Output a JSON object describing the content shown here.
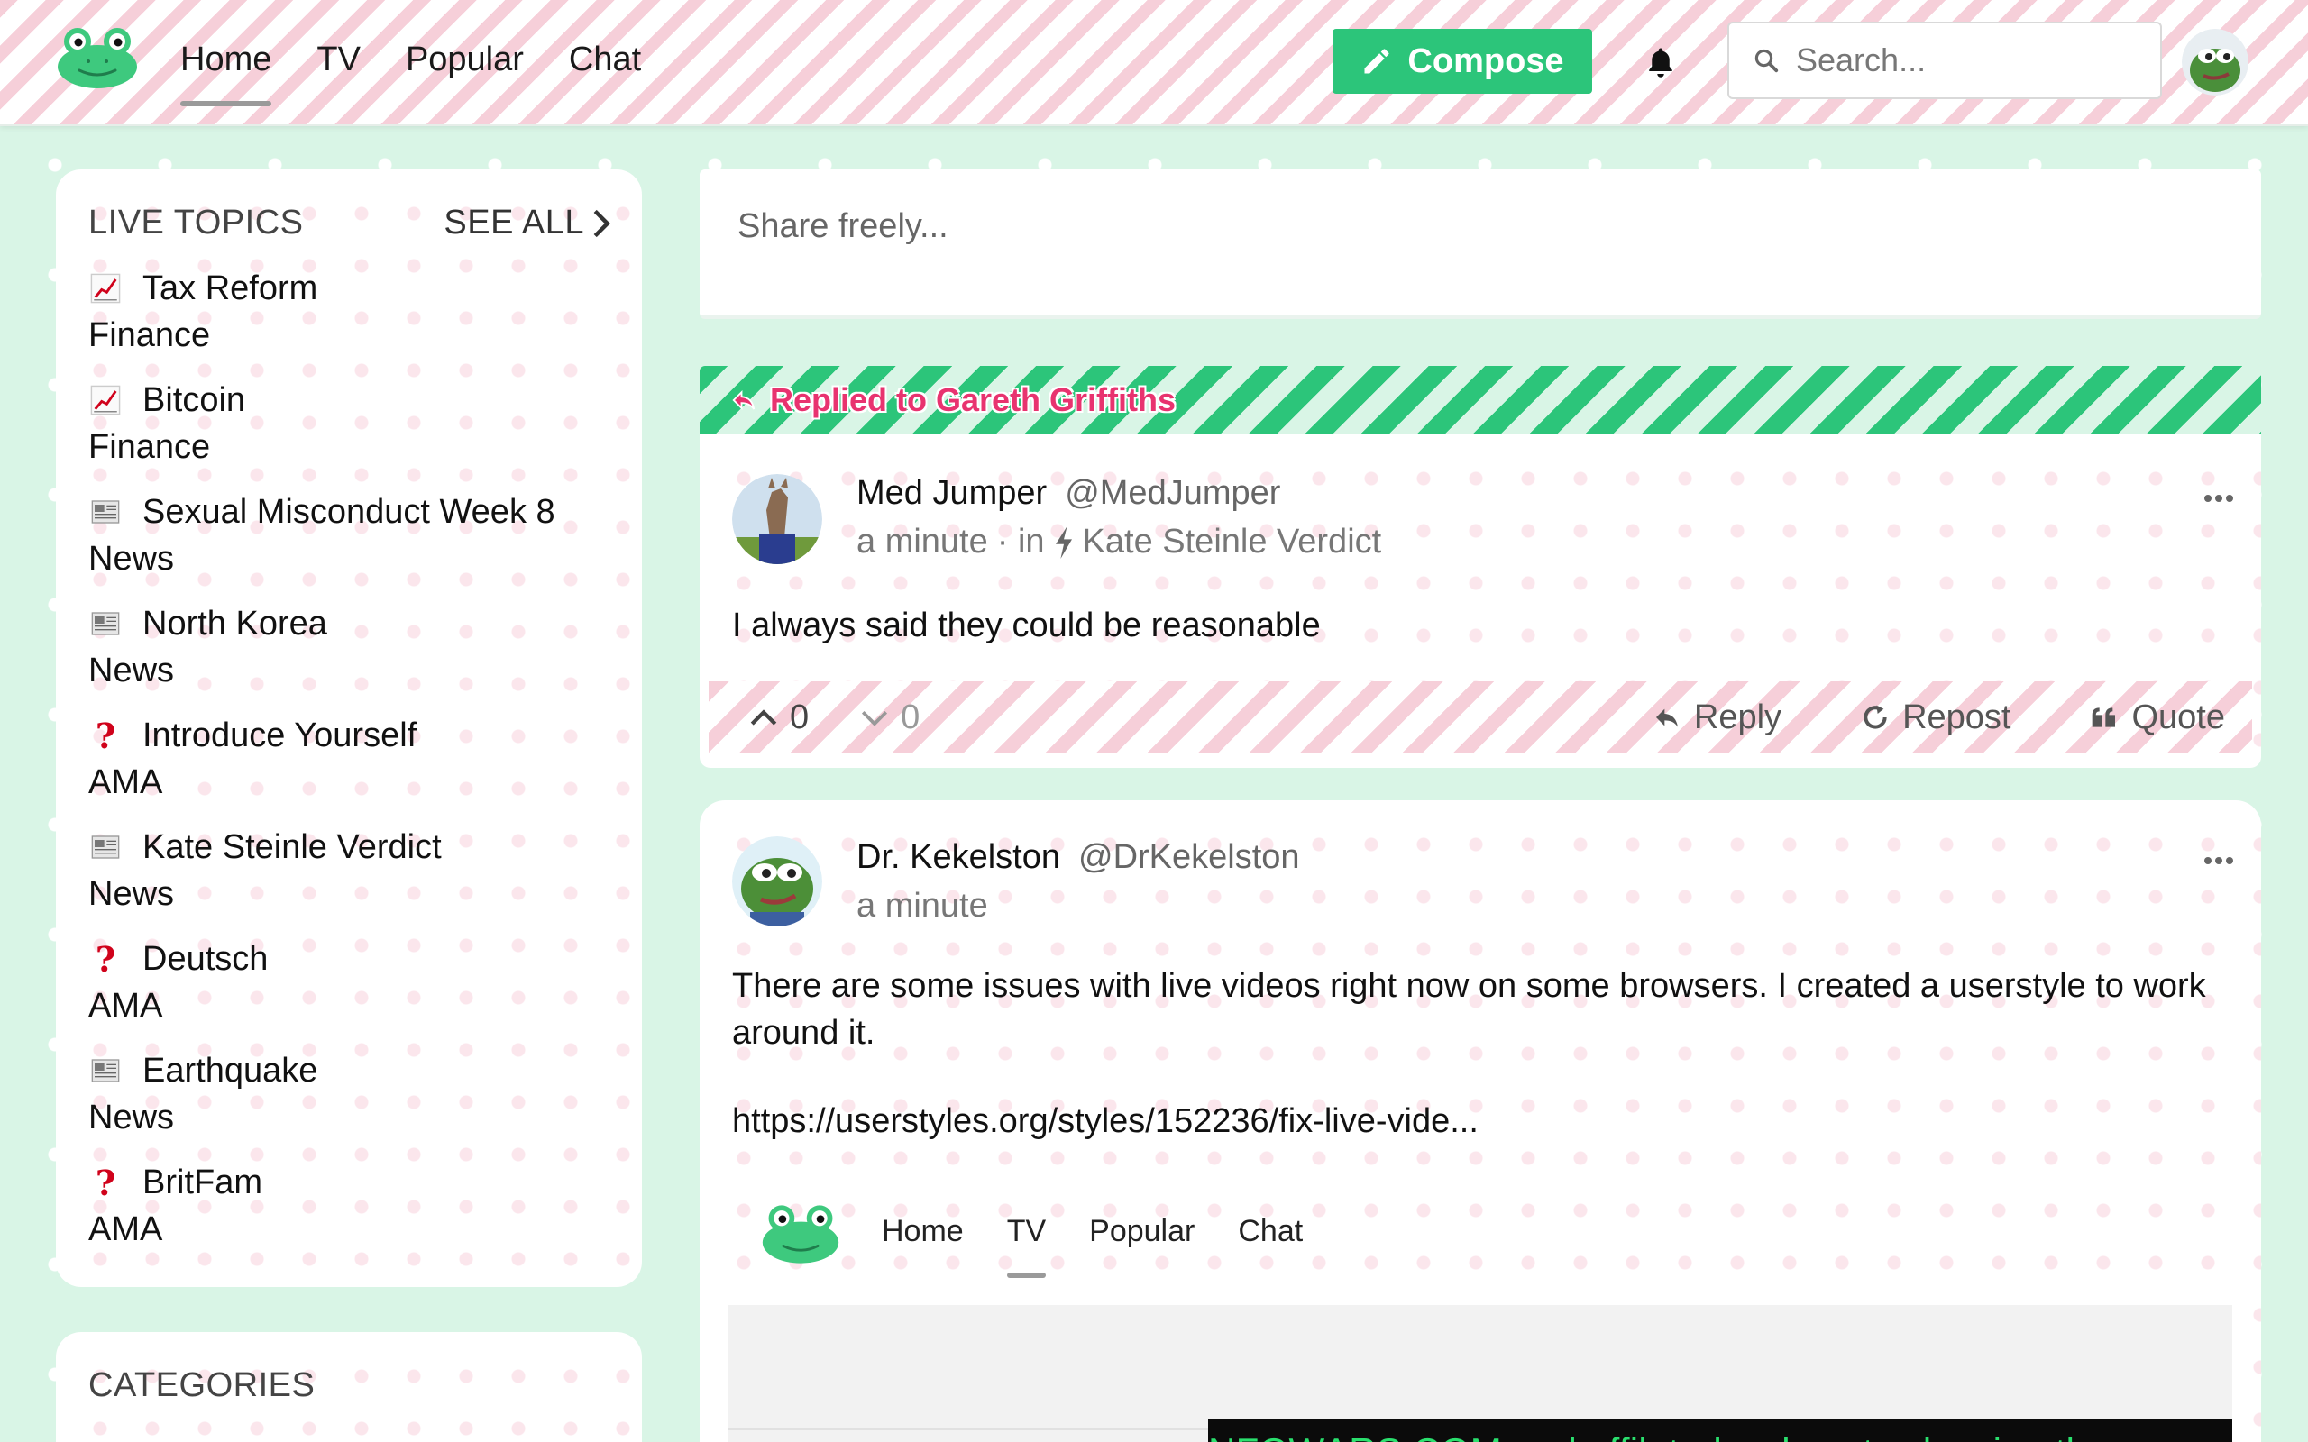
{
  "nav": {
    "items": [
      "Home",
      "TV",
      "Popular",
      "Chat"
    ],
    "compose_label": "Compose",
    "search_placeholder": "Search..."
  },
  "sidebar": {
    "topics_title": "LIVE TOPICS",
    "see_all": "SEE ALL",
    "topics": [
      {
        "title": "Tax Reform",
        "category": "Finance",
        "icon": "chart-icon"
      },
      {
        "title": "Bitcoin",
        "category": "Finance",
        "icon": "chart-icon"
      },
      {
        "title": "Sexual Misconduct Week 8",
        "category": "News",
        "icon": "newspaper-icon"
      },
      {
        "title": "North Korea",
        "category": "News",
        "icon": "newspaper-icon"
      },
      {
        "title": "Introduce Yourself",
        "category": "AMA",
        "icon": "question-icon"
      },
      {
        "title": "Kate Steinle Verdict",
        "category": "News",
        "icon": "newspaper-icon"
      },
      {
        "title": "Deutsch",
        "category": "AMA",
        "icon": "question-icon"
      },
      {
        "title": "Earthquake",
        "category": "News",
        "icon": "newspaper-icon"
      },
      {
        "title": "BritFam",
        "category": "AMA",
        "icon": "question-icon"
      }
    ],
    "categories_title": "CATEGORIES"
  },
  "composer": {
    "placeholder": "Share freely..."
  },
  "posts": [
    {
      "reply_banner": "Replied to Gareth Griffiths",
      "name": "Med Jumper",
      "handle": "@MedJumper",
      "time": "a minute",
      "in_label": "· in",
      "topic": "Kate Steinle Verdict",
      "body": "I always said they could be reasonable",
      "upvotes": "0",
      "downvotes": "0",
      "reply_label": "Reply",
      "repost_label": "Repost",
      "quote_label": "Quote"
    },
    {
      "name": "Dr. Kekelston",
      "handle": "@DrKekelston",
      "time": "a minute",
      "body": "There are some issues with live videos right now on some browsers. I created a userstyle to work around it.",
      "link": "https://userstyles.org/styles/152236/fix-live-vide...",
      "embed": {
        "nav_items": [
          "Home",
          "TV",
          "Popular",
          "Chat"
        ],
        "video_caption": "NFOWARS.COM and affilated webcasts showing th"
      }
    }
  ],
  "colors": {
    "brand_green": "#2cc57a",
    "reply_pink": "#e8336f",
    "background_mint": "#d9f5e6"
  }
}
